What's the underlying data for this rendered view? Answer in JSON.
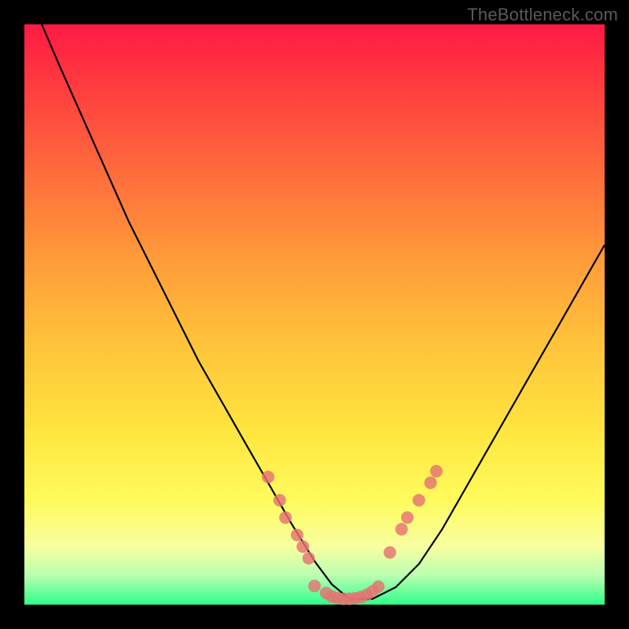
{
  "watermark": {
    "text": "TheBottleneck.com"
  },
  "chart_data": {
    "type": "line",
    "title": "",
    "xlabel": "",
    "ylabel": "",
    "xlim": [
      0,
      100
    ],
    "ylim": [
      0,
      100
    ],
    "grid": false,
    "legend": false,
    "series": [
      {
        "name": "curve",
        "color": "#000000",
        "x": [
          3,
          6,
          10,
          14,
          18,
          22,
          26,
          30,
          34,
          38,
          42,
          46,
          50,
          53,
          56,
          60,
          64,
          68,
          72,
          76,
          80,
          84,
          88,
          92,
          96,
          100
        ],
        "y": [
          100,
          93,
          84,
          75,
          66,
          58,
          50,
          42,
          35,
          28,
          21,
          14,
          7.5,
          3.5,
          1,
          1,
          3,
          7,
          13,
          20,
          27,
          34,
          41,
          48,
          55,
          62
        ]
      }
    ],
    "markers": [
      {
        "name": "left-cluster",
        "color": "#e57373",
        "x": [
          42,
          44,
          45,
          47,
          48,
          49
        ],
        "y": [
          22,
          18,
          15,
          12,
          10,
          8
        ]
      },
      {
        "name": "bottom-cluster",
        "color": "#e57373",
        "x": [
          50,
          52,
          53,
          54,
          55,
          56,
          57,
          58,
          59,
          60,
          61
        ],
        "y": [
          3.2,
          2.0,
          1.4,
          1.1,
          1.0,
          1.0,
          1.1,
          1.3,
          1.7,
          2.3,
          3.1
        ]
      },
      {
        "name": "right-cluster",
        "color": "#e57373",
        "x": [
          63,
          65,
          66,
          68,
          70,
          71
        ],
        "y": [
          9,
          13,
          15,
          18,
          21,
          23
        ]
      }
    ]
  }
}
